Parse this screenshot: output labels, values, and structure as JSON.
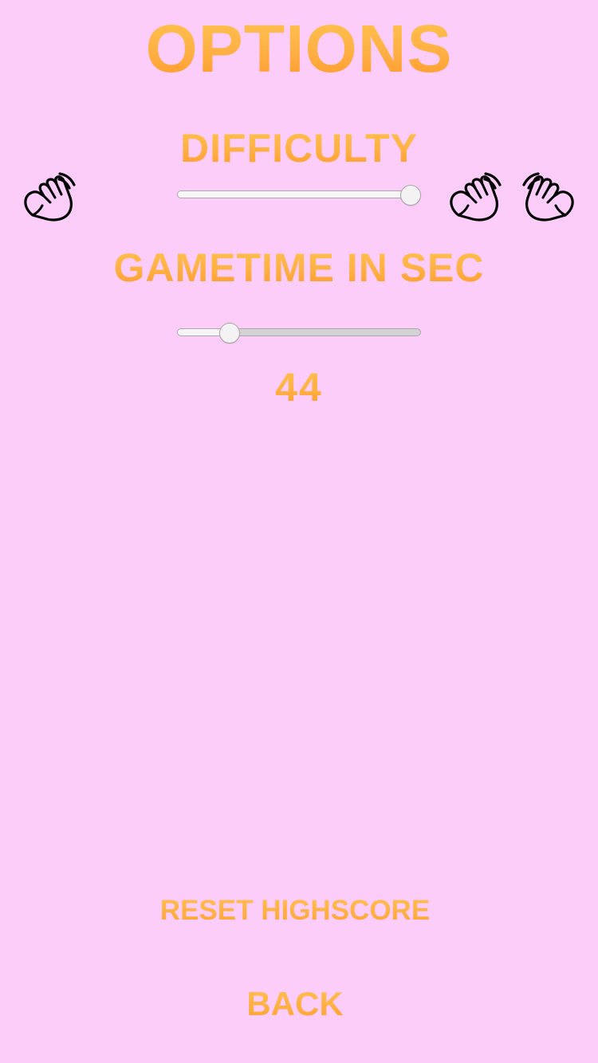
{
  "header": {
    "title": "OPTIONS"
  },
  "difficulty": {
    "label": "DIFFICULTY",
    "level": 1.0,
    "hand_icons": [
      "one-hand-icon",
      "two-hands-icon"
    ]
  },
  "gametime": {
    "label": "GAMETIME IN SEC",
    "value": "44",
    "level": 0.19
  },
  "actions": {
    "reset_label": "RESET HIGHSCORE",
    "back_label": "BACK"
  },
  "colors": {
    "background": "#FDCDFA",
    "text_gradient_top": "#FFC34F",
    "text_gradient_bottom": "#FF9A2C",
    "slider_track": "#D3D3D3",
    "slider_fill": "#F5F5F5",
    "icon_stroke": "#000000"
  }
}
